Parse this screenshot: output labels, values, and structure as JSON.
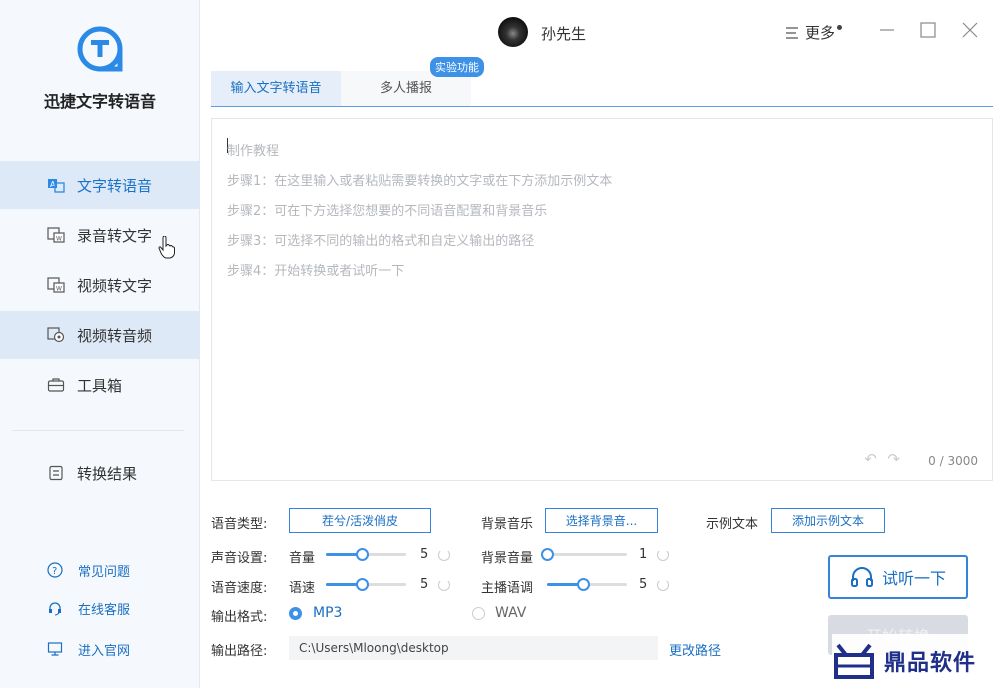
{
  "app": {
    "name": "迅捷文字转语音",
    "accent": "#1a6fc2"
  },
  "header": {
    "username": "孙先生",
    "more_label": "更多"
  },
  "sidebar": {
    "items": [
      {
        "label": "文字转语音",
        "icon": "text-to-speech-icon"
      },
      {
        "label": "录音转文字",
        "icon": "audio-to-text-icon"
      },
      {
        "label": "视频转文字",
        "icon": "video-to-text-icon"
      },
      {
        "label": "视频转音频",
        "icon": "video-to-audio-icon"
      },
      {
        "label": "工具箱",
        "icon": "toolbox-icon"
      },
      {
        "label": "转换结果",
        "icon": "results-icon"
      }
    ],
    "footer": [
      {
        "label": "常见问题",
        "icon": "help-icon"
      },
      {
        "label": "在线客服",
        "icon": "headset-icon"
      },
      {
        "label": "进入官网",
        "icon": "monitor-icon"
      }
    ]
  },
  "tabs": [
    {
      "label": "输入文字转语音"
    },
    {
      "label": "多人播报"
    }
  ],
  "badge": "实验功能",
  "editor": {
    "placeholder_lines": [
      "制作教程",
      "步骤1：在这里输入或者粘贴需要转换的文字或在下方添加示例文本",
      "步骤2：可在下方选择您想要的不同语音配置和背景音乐",
      "步骤3：可选择不同的输出的格式和自定义输出的路径",
      "步骤4：开始转换或者试听一下"
    ],
    "counter": "0 / 3000"
  },
  "settings": {
    "voice_type_label": "语音类型:",
    "voice_type_value": "茬兮/活泼俏皮",
    "bgm_label": "背景音乐",
    "bgm_button": "选择背景音...",
    "sample_label": "示例文本",
    "sample_button": "添加示例文本",
    "sound_label": "声音设置:",
    "volume_label": "音量",
    "volume_value": "5",
    "volume_level": 0.45,
    "bgm_volume_label": "背景音量",
    "bgm_volume_value": "1",
    "bgm_volume_level": 0.0,
    "speed_label": "语音速度:",
    "speed_sub_label": "语速",
    "speed_value": "5",
    "speed_level": 0.45,
    "pitch_label": "主播语调",
    "pitch_value": "5",
    "pitch_level": 0.45,
    "format_label": "输出格式:",
    "format_options": [
      "MP3",
      "WAV"
    ],
    "format_selected": "MP3",
    "path_label": "输出路径:",
    "path_value": "C:\\Users\\Mloong\\desktop",
    "change_path": "更改路径"
  },
  "actions": {
    "listen": "试听一下",
    "convert": "开始转换"
  },
  "watermark": "鼎品软件"
}
